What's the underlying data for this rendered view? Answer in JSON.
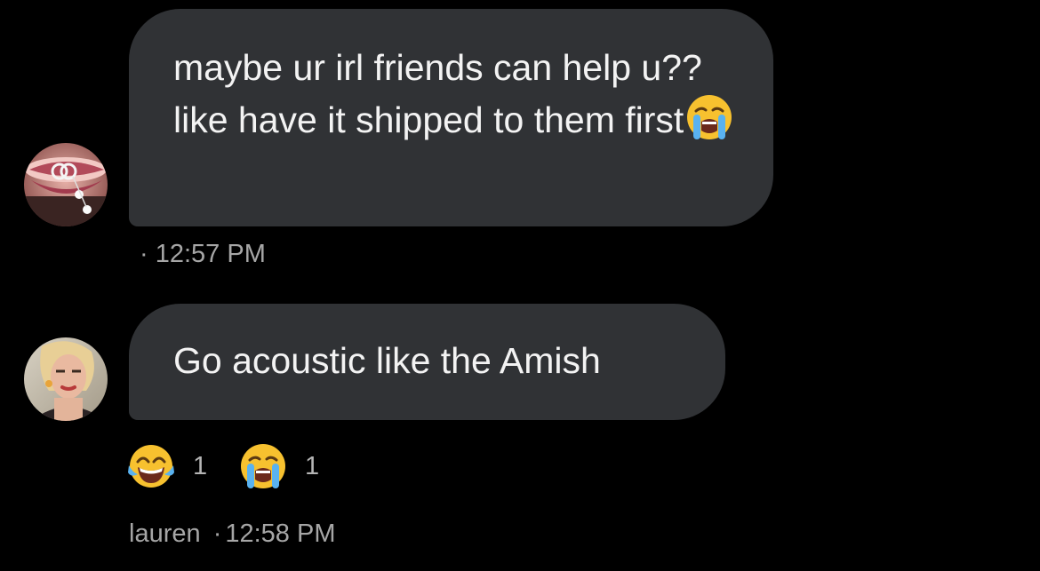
{
  "conversation": {
    "messages": [
      {
        "text": "maybe ur irl friends can help u?? like have it shipped to them first",
        "emoji": "loudly-crying-face",
        "sender": "",
        "time": "12:57 PM",
        "avatar": "avatar-lips-jewelry"
      },
      {
        "text": "Go acoustic like the Amish",
        "sender": "lauren",
        "time": "12:58 PM",
        "avatar": "avatar-blonde-woman",
        "reactions": [
          {
            "emoji": "face-with-tears-of-joy",
            "count": "1"
          },
          {
            "emoji": "loudly-crying-face",
            "count": "1"
          }
        ]
      }
    ],
    "separator": "·"
  },
  "colors": {
    "background": "#000000",
    "bubble": "#303235",
    "bubble_text": "#f3f3f3",
    "meta_text": "#a6a6a6"
  }
}
